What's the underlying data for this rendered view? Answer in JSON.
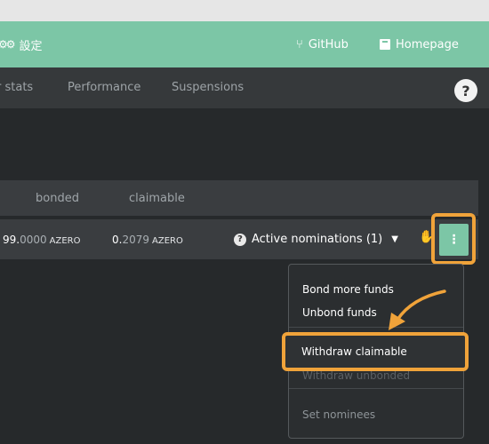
{
  "header": {
    "settings_label": "設定",
    "github_label": "GitHub",
    "homepage_label": "Homepage"
  },
  "tabs": {
    "stats": "r stats",
    "performance": "Performance",
    "suspensions": "Suspensions",
    "help": "?"
  },
  "table": {
    "headers": {
      "bonded": "bonded",
      "claimable": "claimable"
    },
    "row": {
      "bonded_int": "99.",
      "bonded_dec": "0000",
      "claimable_int": "0.",
      "claimable_dec": "2079",
      "unit": "AZERO",
      "nominations": "Active nominations (1)"
    }
  },
  "menu": {
    "bond_more": "Bond more funds",
    "unbond": "Unbond funds",
    "withdraw_claimable": "Withdraw claimable",
    "withdraw_unbonded": "Withdraw unbonded",
    "set_nominees": "Set nominees"
  },
  "icons": {
    "settings": "gear-icon",
    "github": "branch-icon",
    "homepage": "book-icon",
    "help": "question-icon",
    "kebab": "kebab-icon",
    "hand": "hand-icon"
  },
  "colors": {
    "accent": "#7cc6a6",
    "highlight": "#f0a33a"
  }
}
